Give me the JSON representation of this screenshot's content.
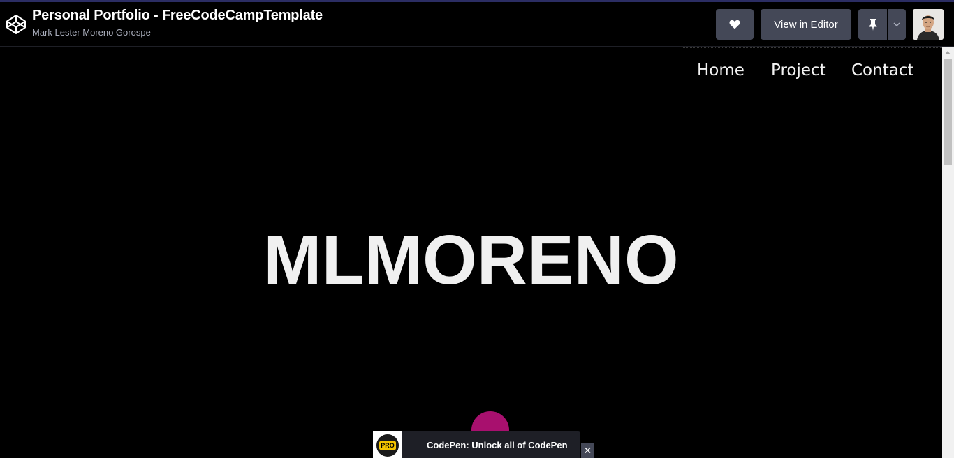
{
  "header": {
    "title": "Personal Portfolio - FreeCodeCampTemplate",
    "author": "Mark Lester Moreno Gorospe",
    "view_in_editor_label": "View in Editor",
    "icons": {
      "logo": "codepen-logo-icon",
      "heart": "heart-icon",
      "pin": "pin-icon",
      "caret": "chevron-down-icon"
    }
  },
  "preview": {
    "nav": {
      "home": "Home",
      "project": "Project",
      "contact": "Contact"
    },
    "hero_text": "MLMORENO",
    "accent_color": "#a8106e"
  },
  "promo": {
    "badge": "PRO",
    "text": "CodePen: Unlock all of CodePen",
    "close_label": "✕"
  },
  "colors": {
    "button_bg": "#444857",
    "topline": "#2b2d63"
  }
}
